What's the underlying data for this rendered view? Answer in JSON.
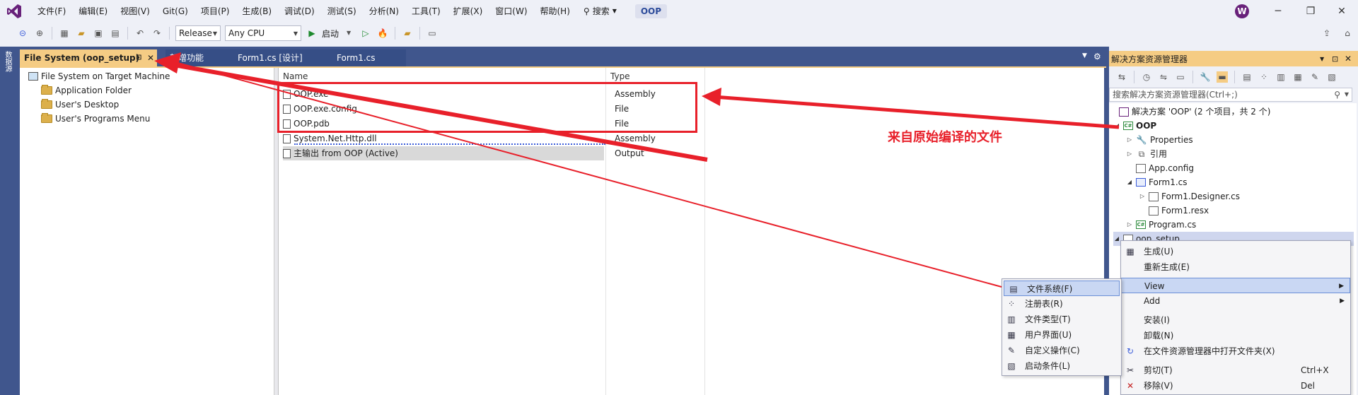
{
  "menubar": {
    "items": [
      "文件(F)",
      "编辑(E)",
      "视图(V)",
      "Git(G)",
      "项目(P)",
      "生成(B)",
      "调试(D)",
      "测试(S)",
      "分析(N)",
      "工具(T)",
      "扩展(X)",
      "窗口(W)",
      "帮助(H)"
    ],
    "search_label": "搜索",
    "solution_badge": "OOP",
    "avatar_letter": "W"
  },
  "toolbar": {
    "config": "Release",
    "platform": "Any CPU",
    "start_label": "启动"
  },
  "left_strip_label": "数据源",
  "tabs": {
    "active": "File System (oop_setup)",
    "items": [
      "新增功能",
      "Form1.cs [设计]",
      "Form1.cs"
    ]
  },
  "fs_tree": {
    "root": "File System on Target Machine",
    "children": [
      "Application Folder",
      "User's Desktop",
      "User's Programs Menu"
    ]
  },
  "fs_list": {
    "headers": {
      "name": "Name",
      "type": "Type"
    },
    "rows": [
      {
        "name": "OOP.exe",
        "type": "Assembly"
      },
      {
        "name": "OOP.exe.config",
        "type": "File"
      },
      {
        "name": "OOP.pdb",
        "type": "File"
      },
      {
        "name": "System.Net.Http.dll",
        "type": "Assembly"
      },
      {
        "name": "主输出 from OOP (Active)",
        "type": "Output"
      }
    ]
  },
  "annotation": {
    "text": "来自原始编译的文件",
    "color": "#e8202a"
  },
  "solution_explorer": {
    "title": "解决方案资源管理器",
    "search_placeholder": "搜索解决方案资源管理器(Ctrl+;)",
    "solution": "解决方案 'OOP' (2 个项目，共 2 个)",
    "project": "OOP",
    "nodes": [
      "Properties",
      "引用",
      "App.config",
      "Form1.cs",
      "Form1.Designer.cs",
      "Form1.resx",
      "Program.cs"
    ],
    "setup_project": "oop_setup"
  },
  "context_menu": {
    "items": [
      {
        "label": "生成(U)",
        "icon": "build-icon"
      },
      {
        "label": "重新生成(E)",
        "icon": ""
      },
      {
        "label": "View",
        "icon": "",
        "submenu": true
      },
      {
        "label": "Add",
        "icon": "",
        "submenu": true
      },
      {
        "label": "安装(I)",
        "icon": ""
      },
      {
        "label": "卸载(N)",
        "icon": ""
      },
      {
        "label": "在文件资源管理器中打开文件夹(X)",
        "icon": "refresh-icon"
      },
      {
        "label": "剪切(T)",
        "shortcut": "Ctrl+X",
        "icon": "cut-icon"
      },
      {
        "label": "移除(V)",
        "shortcut": "Del",
        "icon": "remove-icon"
      }
    ]
  },
  "view_submenu": {
    "items": [
      "文件系统(F)",
      "注册表(R)",
      "文件类型(T)",
      "用户界面(U)",
      "自定义操作(C)",
      "启动条件(L)"
    ]
  },
  "colors": {
    "accent_tab": "#f5cc84",
    "editor_frame": "#40568d",
    "annotation_red": "#e8202a"
  }
}
